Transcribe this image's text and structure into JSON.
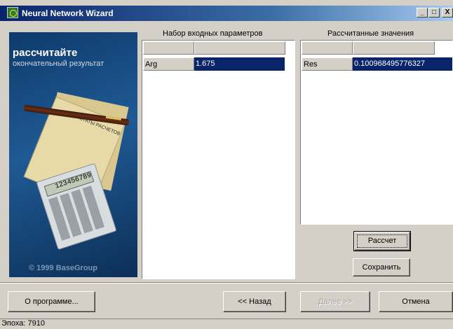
{
  "window": {
    "title": "Neural Network Wizard",
    "minimize_glyph": "_",
    "maximize_glyph": "□",
    "close_glyph": "X"
  },
  "banner": {
    "title": "рассчитайте",
    "subtitle": "окончательный результат",
    "paper_caption": "РЕЗУЛЬТАТЫ РАСЧЕТОВ",
    "calculator_display": "123456789",
    "copyright": "© 1999 BaseGroup"
  },
  "input_panel": {
    "title": "Набор входных параметров",
    "rows": [
      {
        "name": "Arg",
        "value": "1.675"
      }
    ]
  },
  "output_panel": {
    "title": "Рассчитанные значения",
    "rows": [
      {
        "name": "Res",
        "value": "0.100968495776327"
      }
    ]
  },
  "buttons": {
    "calculate": "Рассчет",
    "save": "Сохранить",
    "about": "О программе...",
    "back": "<< Назад",
    "next": "Далее >>",
    "cancel": "Отмена"
  },
  "status": {
    "text": "Эпоха: 7910"
  },
  "colors": {
    "title_bar": "#0a246a",
    "selection": "#0a246a",
    "face": "#d4d0c8"
  }
}
